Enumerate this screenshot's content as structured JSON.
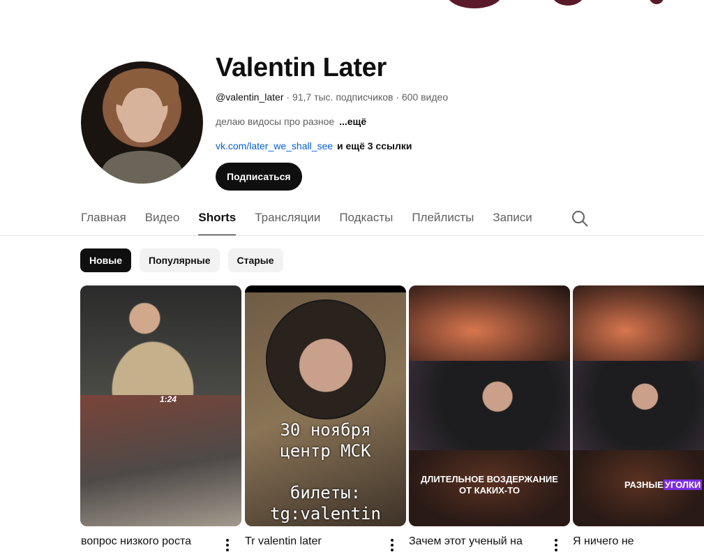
{
  "channel": {
    "name": "Valentin Later",
    "handle": "@valentin_later",
    "stats": " · 91,7 тыс. подписчиков · 600 видео",
    "description": "делаю видосы про разное",
    "description_more": "...ещё",
    "link": "vk.com/later_we_shall_see",
    "links_more": "и ещё 3 ссылки",
    "subscribe_label": "Подписаться"
  },
  "tabs": [
    {
      "label": "Главная",
      "active": false
    },
    {
      "label": "Видео",
      "active": false
    },
    {
      "label": "Shorts",
      "active": true
    },
    {
      "label": "Трансляции",
      "active": false
    },
    {
      "label": "Подкасты",
      "active": false
    },
    {
      "label": "Плейлисты",
      "active": false
    },
    {
      "label": "Записи",
      "active": false
    }
  ],
  "chips": [
    {
      "label": "Новые",
      "active": true
    },
    {
      "label": "Популярные",
      "active": false
    },
    {
      "label": "Старые",
      "active": false
    }
  ],
  "shorts": [
    {
      "title": "вопрос низкого роста",
      "overlay": "1:24"
    },
    {
      "title": "Tr valentin later",
      "overlay_lines": [
        "30 ноября",
        "центр МСК",
        "билеты:",
        "tg:valentin later"
      ]
    },
    {
      "title": "Зачем этот ученый на",
      "overlay_lines": [
        "Длительное воздержание",
        "от каких-то"
      ]
    },
    {
      "title": "Я ничего не",
      "overlay_plain": "Разные",
      "overlay_highlight": "уголки"
    }
  ],
  "colors": {
    "link": "#065fd4",
    "active": "#0f0f0f",
    "highlight": "#7b2de0"
  }
}
